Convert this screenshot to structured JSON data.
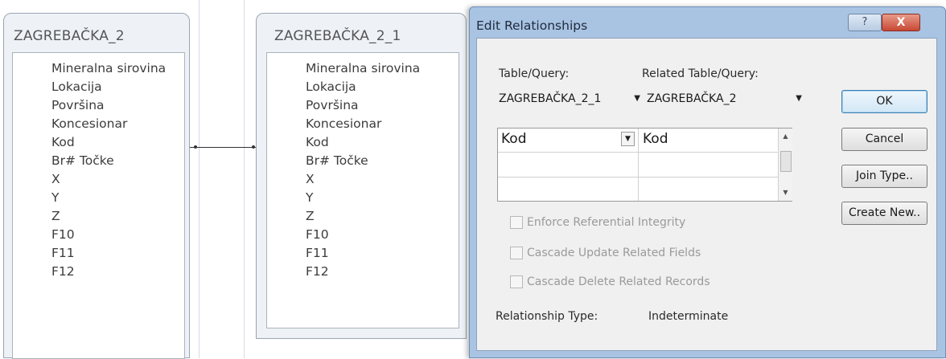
{
  "tables": [
    {
      "title": "ZAGREBAČKA_2",
      "fields": [
        "Mineralna sirovina",
        "Lokacija",
        "Površina",
        "Koncesionar",
        "Kod",
        "Br# Točke",
        "X",
        "Y",
        "Z",
        "F10",
        "F11",
        "F12"
      ]
    },
    {
      "title": "ZAGREBAČKA_2_1",
      "fields": [
        "Mineralna sirovina",
        "Lokacija",
        "Površina",
        "Koncesionar",
        "Kod",
        "Br# Točke",
        "X",
        "Y",
        "Z",
        "F10",
        "F11",
        "F12"
      ]
    }
  ],
  "dialog": {
    "title": "Edit Relationships",
    "help_glyph": "?",
    "close_glyph": "X",
    "table_query_label": "Table/Query:",
    "related_table_label": "Related Table/Query:",
    "table_query_value": "ZAGREBAČKA_2_1",
    "related_table_value": "ZAGREBAČKA_2",
    "field_rows": [
      {
        "left": "Kod",
        "right": "Kod"
      },
      {
        "left": "",
        "right": ""
      },
      {
        "left": "",
        "right": ""
      }
    ],
    "checkboxes": [
      {
        "label": "Enforce Referential Integrity",
        "checked": false,
        "enabled": false
      },
      {
        "label": "Cascade Update Related Fields",
        "checked": false,
        "enabled": false
      },
      {
        "label": "Cascade Delete Related Records",
        "checked": false,
        "enabled": false
      }
    ],
    "relationship_type_label": "Relationship Type:",
    "relationship_type_value": "Indeterminate",
    "buttons": {
      "ok": "OK",
      "cancel": "Cancel",
      "join_type": "Join Type..",
      "create_new": "Create New.."
    }
  }
}
